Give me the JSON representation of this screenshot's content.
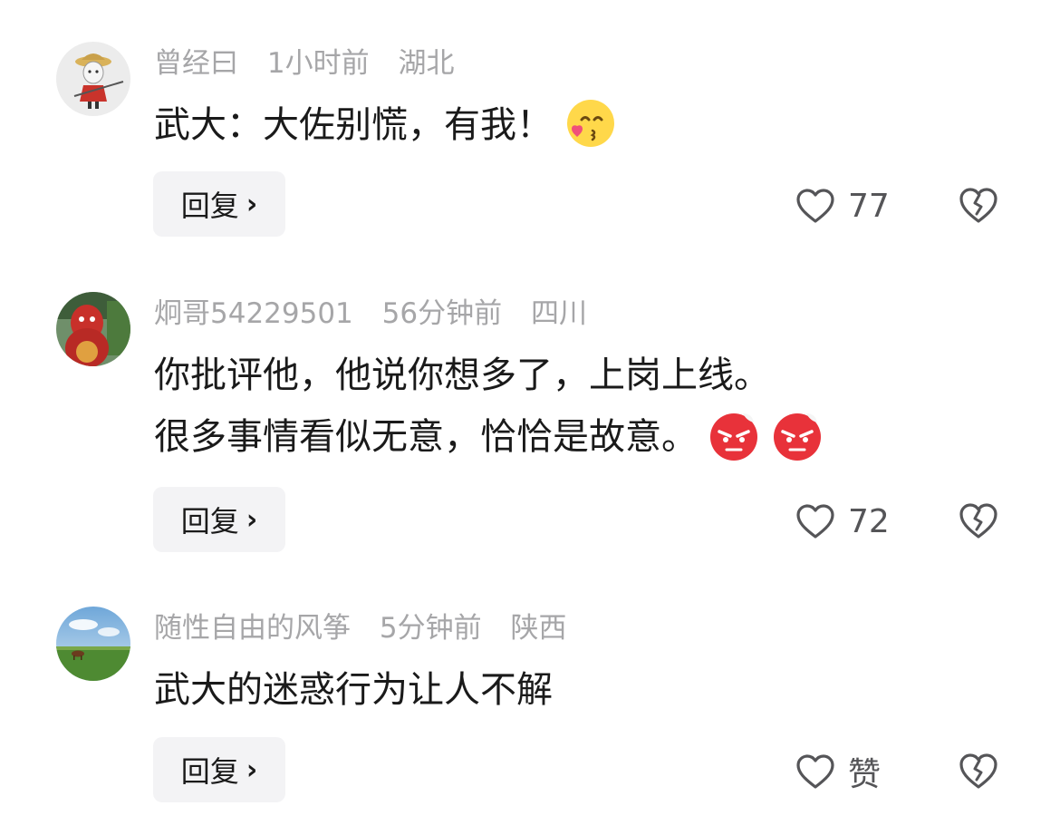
{
  "comments": [
    {
      "username": "曾经曰",
      "time": "1小时前",
      "location": "湖北",
      "lines": [
        "武大：大佐别慌，有我！"
      ],
      "reply_label": "回复",
      "likes": "77"
    },
    {
      "username": "炯哥54229501",
      "time": "56分钟前",
      "location": "四川",
      "lines": [
        "你批评他，他说你想多了，上岗上线。",
        "很多事情看似无意，恰恰是故意。"
      ],
      "reply_label": "回复",
      "likes": "72"
    },
    {
      "username": "随性自由的风筝",
      "time": "5分钟前",
      "location": "陕西",
      "lines": [
        "武大的迷惑行为让人不解"
      ],
      "reply_label": "回复",
      "likes": "赞"
    }
  ],
  "icons": {
    "reply_chevron": "›",
    "like": "heart-outline-icon",
    "dislike": "broken-heart-icon"
  },
  "colors": {
    "meta_text": "#a6a6a8",
    "body_text": "#1a1a1a",
    "reply_bg": "#f3f3f5",
    "icon": "#555558"
  }
}
